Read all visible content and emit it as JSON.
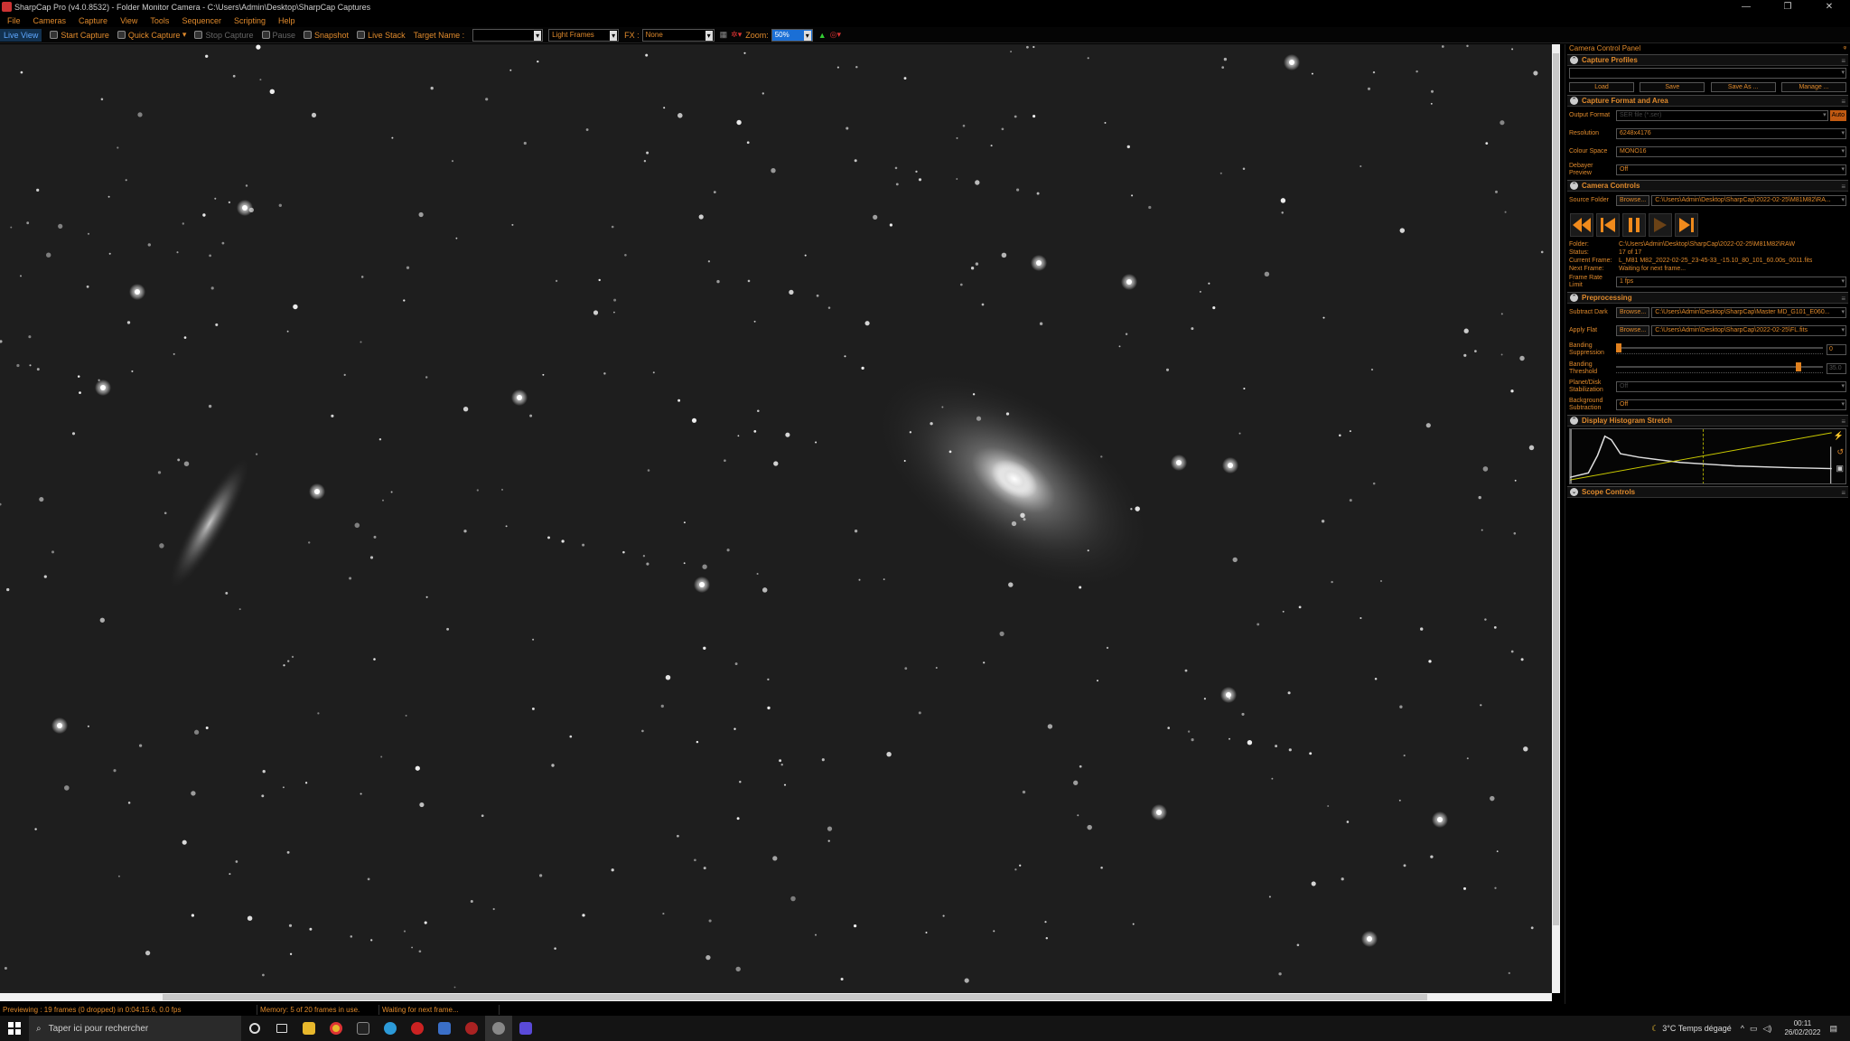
{
  "window": {
    "title": "SharpCap Pro (v4.0.8532) - Folder Monitor Camera - C:\\Users\\Admin\\Desktop\\SharpCap Captures",
    "controls": [
      "—",
      "❐",
      "✕"
    ]
  },
  "menu": [
    "File",
    "Cameras",
    "Capture",
    "View",
    "Tools",
    "Sequencer",
    "Scripting",
    "Help"
  ],
  "toolbar": {
    "live_view": "Live View",
    "start_capture": "Start Capture",
    "quick_capture": "Quick Capture",
    "stop_capture": "Stop Capture",
    "pause": "Pause",
    "snapshot": "Snapshot",
    "live_stack": "Live Stack",
    "target_name_label": "Target Name :",
    "target_name_value": "",
    "frame_type": "Light Frames",
    "fx_label": "FX :",
    "fx_value": "None",
    "zoom_label": "Zoom:",
    "zoom_value": "50%"
  },
  "status": {
    "preview": "Previewing : 19 frames (0 dropped) in 0:04:15.6, 0.0 fps",
    "memory": "Memory: 5 of 20 frames in use.",
    "waiting": "Waiting for next frame..."
  },
  "panel": {
    "title": "Camera Control Panel",
    "pin": "ᵠ",
    "capture_profiles": {
      "header": "Capture Profiles",
      "value": "",
      "buttons": [
        "Load",
        "Save",
        "Save As ...",
        "Manage ..."
      ]
    },
    "format": {
      "header": "Capture Format and Area",
      "output_format_label": "Output Format",
      "output_format_value": "SER file (*.ser)",
      "auto": "Auto",
      "resolution_label": "Resolution",
      "resolution_value": "6248x4176",
      "colour_space_label": "Colour Space",
      "colour_space_value": "MONO16",
      "debayer_label": "Debayer Preview",
      "debayer_value": "Off"
    },
    "camera_controls": {
      "header": "Camera Controls",
      "source_folder_label": "Source Folder",
      "browse": "Browse...",
      "source_folder_value": "C:\\Users\\Admin\\Desktop\\SharpCap\\2022-02-25\\M81M82\\RA...",
      "folder_label": "Folder:",
      "folder_value": "C:\\Users\\Admin\\Desktop\\SharpCap\\2022-02-25\\M81M82\\RAW",
      "status_label": "Status:",
      "status_value": "17 of 17",
      "current_frame_label": "Current Frame:",
      "current_frame_value": "L_M81 M82_2022-02-25_23-45-33_-15.10_80_101_60.00s_0011.fits",
      "next_frame_label": "Next Frame:",
      "next_frame_value": "Waiting for next frame...",
      "frame_rate_label": "Frame Rate Limit",
      "frame_rate_value": "1 fps"
    },
    "preprocessing": {
      "header": "Preprocessing",
      "subtract_dark_label": "Subtract Dark",
      "subtract_dark_value": "C:\\Users\\Admin\\Desktop\\SharpCap\\Master MD_G101_E060...",
      "apply_flat_label": "Apply Flat",
      "apply_flat_value": "C:\\Users\\Admin\\Desktop\\SharpCap\\2022-02-25\\FL.fits",
      "banding_suppression_label": "Banding Suppression",
      "banding_suppression_value": "0",
      "banding_suppression_level": 0.0,
      "banding_threshold_label": "Banding Threshold",
      "banding_threshold_value": "35.0",
      "banding_threshold_level": 0.88,
      "planet_disk_label": "Planet/Disk Stabilization",
      "planet_disk_value": "Off",
      "background_label": "Background Subtraction",
      "background_value": "Off"
    },
    "histogram": {
      "header": "Display Histogram Stretch"
    },
    "scope": {
      "header": "Scope Controls"
    }
  },
  "taskbar": {
    "search_placeholder": "Taper ici pour rechercher",
    "weather": "3°C  Temps dégagé",
    "time": "00:11",
    "date": "26/02/2022"
  },
  "colors": {
    "accent": "#e08a2c",
    "sky": "#1e1e1e",
    "zoom_highlight": "#1a6fd6"
  }
}
